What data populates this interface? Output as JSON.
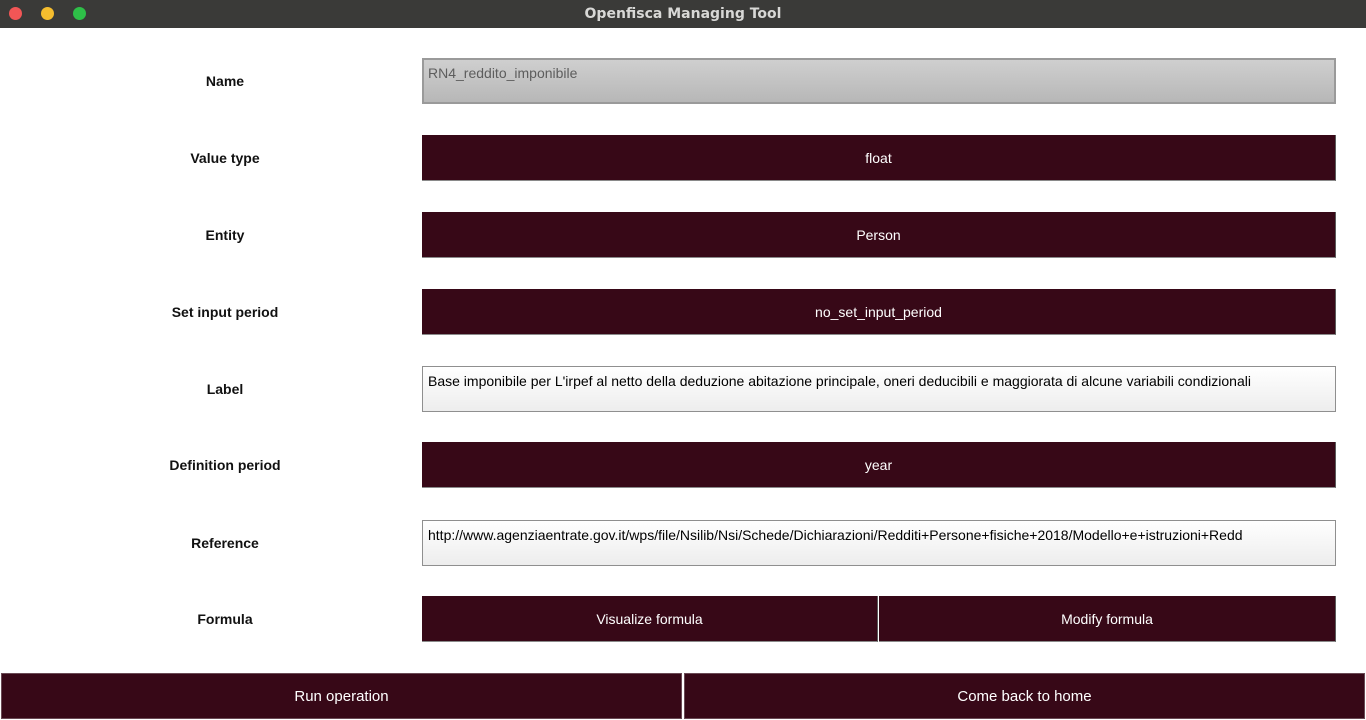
{
  "window": {
    "title": "Openfisca Managing Tool",
    "controls": [
      "close-icon",
      "minimize-icon",
      "maximize-icon"
    ],
    "controls_colors": {
      "close": "#f25656",
      "minimize": "#f5bd2e",
      "maximize": "#2ebf48"
    }
  },
  "form": {
    "name": {
      "label": "Name",
      "value": "RN4_reddito_imponibile"
    },
    "value_type": {
      "label": "Value type",
      "value": "float"
    },
    "entity": {
      "label": "Entity",
      "value": "Person"
    },
    "set_input_period": {
      "label": "Set input period",
      "value": "no_set_input_period"
    },
    "label": {
      "label": "Label",
      "value": "Base imponibile per L'irpef al netto della deduzione abitazione principale, oneri deducibili e maggiorata di alcune variabili condizionali"
    },
    "definition_period": {
      "label": "Definition period",
      "value": "year"
    },
    "reference": {
      "label": "Reference",
      "value": "http://www.agenziaentrate.gov.it/wps/file/Nsilib/Nsi/Schede/Dichiarazioni/Redditi+Persone+fisiche+2018/Modello+e+istruzioni+Redd"
    },
    "formula": {
      "label": "Formula",
      "visualize": "Visualize formula",
      "modify": "Modify formula"
    }
  },
  "actions": {
    "run": "Run operation",
    "home": "Come back to home"
  },
  "colors": {
    "button_bg": "#370817",
    "titlebar_bg": "#3a3a38"
  }
}
